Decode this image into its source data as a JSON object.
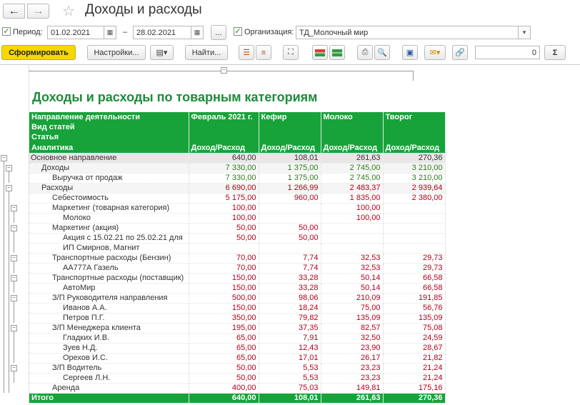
{
  "window": {
    "title": "Доходы и расходы"
  },
  "toolbar": {
    "period_label": "Период:",
    "date_from": "01.02.2021",
    "date_to": "28.02.2021",
    "dash": "–",
    "ellipsis": "...",
    "org_label": "Организация:",
    "org_value": "ТД_Молочный мир",
    "generate": "Сформировать",
    "settings": "Настройки...",
    "find": "Найти...",
    "sum_value": "0",
    "sigma": "Σ"
  },
  "report": {
    "title": "Доходы и расходы по товарным категориям",
    "header_rows": [
      [
        "Направление деятельности",
        "Февраль 2021 г.",
        "Кефир",
        "Молоко",
        "Творог"
      ],
      [
        "Вид статей",
        "",
        "",
        "",
        ""
      ],
      [
        "Статья",
        "",
        "",
        "",
        ""
      ],
      [
        "Аналитика",
        "Доход/Расход",
        "Доход/Расход",
        "Доход/Расход",
        "Доход/Расход"
      ]
    ],
    "rows": [
      {
        "label": "Основное направление",
        "indent": 0,
        "kind": "main",
        "values": [
          "640,00",
          "108,01",
          "261,63",
          "270,36"
        ]
      },
      {
        "label": "Доходы",
        "indent": 1,
        "kind": "sub-pos",
        "values": [
          "7 330,00",
          "1 375,00",
          "2 745,00",
          "3 210,00"
        ]
      },
      {
        "label": "Выручка от продаж",
        "indent": 2,
        "kind": "pos",
        "values": [
          "7 330,00",
          "1 375,00",
          "2 745,00",
          "3 210,00"
        ]
      },
      {
        "label": "Расходы",
        "indent": 1,
        "kind": "sub-neg",
        "values": [
          "6 690,00",
          "1 266,99",
          "2 483,37",
          "2 939,64"
        ]
      },
      {
        "label": "Себестоимость",
        "indent": 2,
        "kind": "neg",
        "values": [
          "5 175,00",
          "960,00",
          "1 835,00",
          "2 380,00"
        ]
      },
      {
        "label": "Маркетинг (товарная категория)",
        "indent": 2,
        "kind": "neg",
        "values": [
          "100,00",
          "",
          "100,00",
          ""
        ]
      },
      {
        "label": "Молоко",
        "indent": 3,
        "kind": "neg",
        "values": [
          "100,00",
          "",
          "100,00",
          ""
        ]
      },
      {
        "label": "Маркетинг (акция)",
        "indent": 2,
        "kind": "neg",
        "values": [
          "50,00",
          "50,00",
          "",
          ""
        ]
      },
      {
        "label": "Акция с 15.02.21 по 25.02.21 для",
        "indent": 3,
        "kind": "neg",
        "values": [
          "50,00",
          "50,00",
          "",
          ""
        ]
      },
      {
        "label": "ИП Смирнов, Магнит",
        "indent": 3,
        "kind": "neg",
        "values": [
          "",
          "",
          "",
          ""
        ]
      },
      {
        "label": "Транспортные расходы (Бензин)",
        "indent": 2,
        "kind": "neg",
        "values": [
          "70,00",
          "7,74",
          "32,53",
          "29,73"
        ]
      },
      {
        "label": "АА777А Газель",
        "indent": 3,
        "kind": "neg",
        "values": [
          "70,00",
          "7,74",
          "32,53",
          "29,73"
        ]
      },
      {
        "label": "Транспортные расходы (поставщик)",
        "indent": 2,
        "kind": "neg",
        "values": [
          "150,00",
          "33,28",
          "50,14",
          "66,58"
        ]
      },
      {
        "label": "АвтоМир",
        "indent": 3,
        "kind": "neg",
        "values": [
          "150,00",
          "33,28",
          "50,14",
          "66,58"
        ]
      },
      {
        "label": "З/П Руководителя направления",
        "indent": 2,
        "kind": "neg",
        "values": [
          "500,00",
          "98,06",
          "210,09",
          "191,85"
        ]
      },
      {
        "label": "Иванов А.А.",
        "indent": 3,
        "kind": "neg",
        "values": [
          "150,00",
          "18,24",
          "75,00",
          "56,76"
        ]
      },
      {
        "label": "Петров П.Г.",
        "indent": 3,
        "kind": "neg",
        "values": [
          "350,00",
          "79,82",
          "135,09",
          "135,09"
        ]
      },
      {
        "label": "З/П Менеджера клиента",
        "indent": 2,
        "kind": "neg",
        "values": [
          "195,00",
          "37,35",
          "82,57",
          "75,08"
        ]
      },
      {
        "label": "Гладких И.В.",
        "indent": 3,
        "kind": "neg",
        "values": [
          "65,00",
          "7,91",
          "32,50",
          "24,59"
        ]
      },
      {
        "label": "Зуев Н.Д.",
        "indent": 3,
        "kind": "neg",
        "values": [
          "65,00",
          "12,43",
          "23,90",
          "28,67"
        ]
      },
      {
        "label": "Орехов И.С.",
        "indent": 3,
        "kind": "neg",
        "values": [
          "65,00",
          "17,01",
          "26,17",
          "21,82"
        ]
      },
      {
        "label": "З/П Водитель",
        "indent": 2,
        "kind": "neg",
        "values": [
          "50,00",
          "5,53",
          "23,23",
          "21,24"
        ]
      },
      {
        "label": "Сергеев Л.Н.",
        "indent": 3,
        "kind": "neg",
        "values": [
          "50,00",
          "5,53",
          "23,23",
          "21,24"
        ]
      },
      {
        "label": "Аренда",
        "indent": 2,
        "kind": "neg",
        "values": [
          "400,00",
          "75,03",
          "149,81",
          "175,16"
        ]
      }
    ],
    "total": {
      "label": "Итого",
      "values": [
        "640,00",
        "108,01",
        "261,63",
        "270,36"
      ]
    }
  }
}
